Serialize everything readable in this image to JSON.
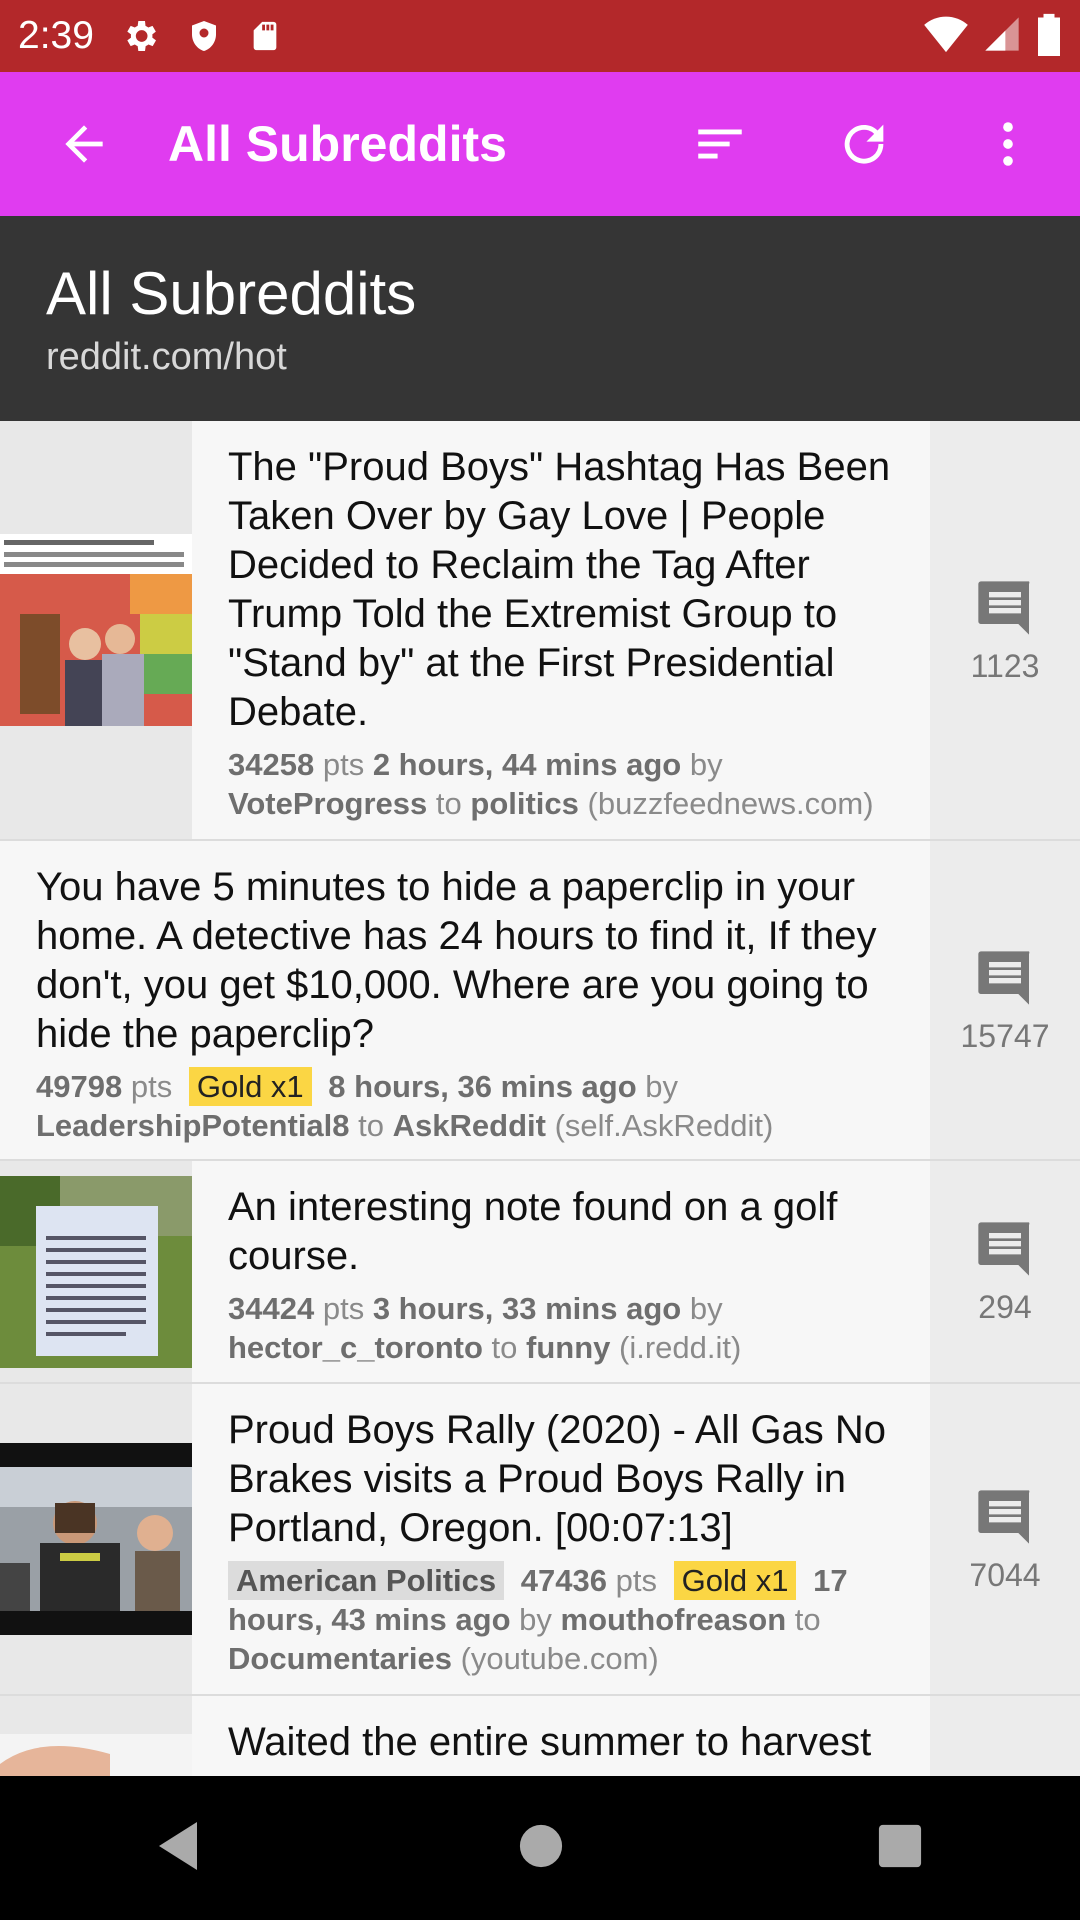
{
  "status_bar": {
    "time": "2:39"
  },
  "app_bar": {
    "title": "All Subreddits"
  },
  "header": {
    "title": "All Subreddits",
    "subtitle": "reddit.com/hot"
  },
  "colors": {
    "status_bar": "#b3282a",
    "app_bar": "#e03cf0",
    "header": "#353535",
    "gold_badge": "#fbd644"
  },
  "posts": [
    {
      "title": "The \"Proud Boys\" Hashtag Has Been Taken Over by Gay Love | People Decided to Reclaim the Tag After Trump Told the Extremist Group to \"Stand by\" at the First Presidential Debate.",
      "points": "34258",
      "time": "2 hours, 44 mins ago",
      "author": "VoteProgress",
      "subreddit": "politics",
      "domain": "(buzzfeednews.com)",
      "comments": "1123"
    },
    {
      "title": "You have 5 minutes to hide a paperclip in your home. A detective has 24 hours to find it, If they don't, you get $10,000. Where are you going to hide the paperclip?",
      "points": "49798",
      "gold": "Gold x1",
      "time": "8 hours, 36 mins ago",
      "author": "LeadershipPotential8",
      "subreddit": "AskReddit",
      "domain": "(self.AskReddit)",
      "comments": "15747"
    },
    {
      "title": "An interesting note found on a golf course.",
      "points": "34424",
      "time": "3 hours, 33 mins ago",
      "author": "hector_c_toronto",
      "subreddit": "funny",
      "domain": "(i.redd.it)",
      "comments": "294"
    },
    {
      "title": "Proud Boys Rally (2020) - All Gas No Brakes visits a Proud Boys Rally in Portland, Oregon. [00:07:13]",
      "flair": "American Politics",
      "points": "47436",
      "gold": "Gold x1",
      "time": "17 hours, 43 mins ago",
      "author": "mouthofreason",
      "subreddit": "Documentaries",
      "domain": "(youtube.com)",
      "comments": "7044"
    },
    {
      "title": "Waited the entire summer to harvest"
    }
  ],
  "labels": {
    "pts": "pts",
    "by": "by",
    "to": "to"
  }
}
